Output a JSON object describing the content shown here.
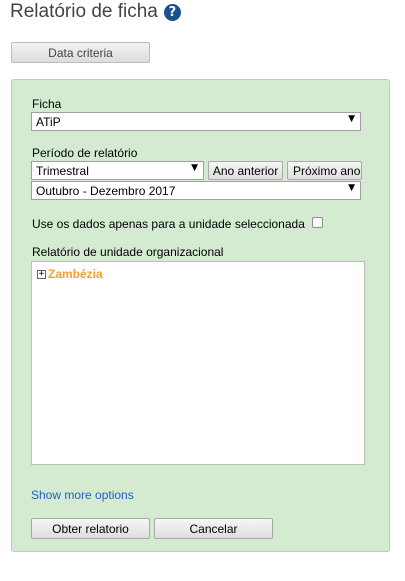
{
  "header": {
    "title": "Relatório de ficha",
    "help_icon_glyph": "?"
  },
  "toolbar": {
    "data_criteria_label": "Data criteria"
  },
  "form": {
    "ficha_label": "Ficha",
    "ficha_value": "ATiP",
    "periodo_label": "Período de relatório",
    "periodo_type_value": "Trimestral",
    "ano_anterior_label": "Ano anterior",
    "proximo_ano_label": "Próximo ano",
    "period_value": "Outubro - Dezembro 2017",
    "use_data_label": "Use os dados apenas para a unidade seleccionada",
    "use_data_checked": false,
    "org_unit_label": "Relatório de unidade organizacional",
    "tree": [
      {
        "label": "Zambézia",
        "expand_glyph": "+"
      }
    ],
    "show_more_label": "Show more options",
    "obter_label": "Obter relatorio",
    "cancelar_label": "Cancelar"
  },
  "colors": {
    "panel_bg": "#d4ebd2",
    "tree_item": "#f0a22e",
    "link": "#1f63b8",
    "help_icon": "#1c4f8c"
  },
  "icons": {
    "dropdown": "chevron-down-icon",
    "help": "help-icon",
    "expand": "expand-icon"
  }
}
